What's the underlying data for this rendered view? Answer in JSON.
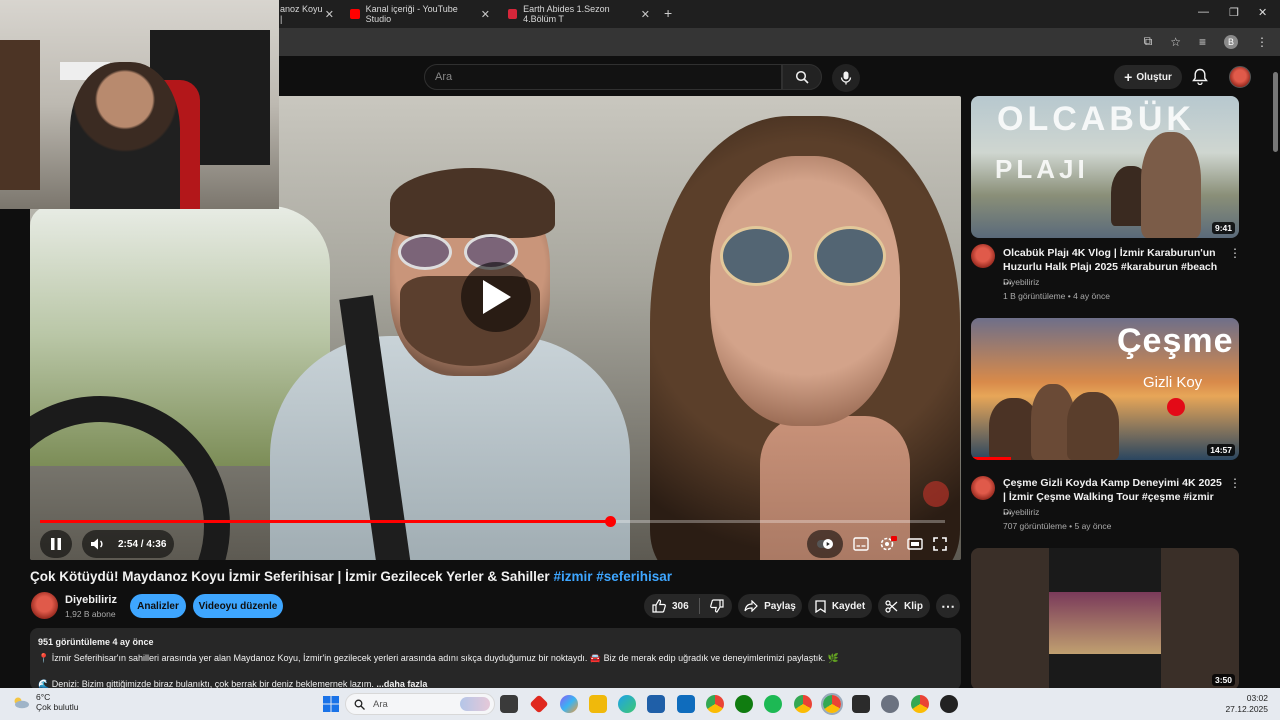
{
  "browser": {
    "tabs": [
      {
        "label": "anoz Koyu | "
      },
      {
        "label": "Kanal içeriği - YouTube Studio"
      },
      {
        "label": "Earth Abides 1.Sezon 4.Bölüm T"
      }
    ],
    "profile_letter": "B"
  },
  "masthead": {
    "search_placeholder": "Ara",
    "create_label": "Oluştur"
  },
  "player": {
    "current_time": "2:54",
    "duration": "4:36",
    "progress_fraction": 0.63
  },
  "video": {
    "title": "Çok Kötüydü! Maydanoz Koyu İzmir Seferihisar | İzmir Gezilecek Yerler & Sahiller ",
    "hashtags": "#izmir #seferihisar",
    "channel_name": "Diyebiliriz",
    "subscribers": "1,92 B abone",
    "analytics_label": "Analizler",
    "edit_label": "Videoyu düzenle",
    "like_count": "306",
    "share_label": "Paylaş",
    "save_label": "Kaydet",
    "clip_label": "Klip"
  },
  "description": {
    "meta": "951 görüntüleme  4 ay önce",
    "line1": "📍 İzmir Seferihisar'ın sahilleri arasında yer alan Maydanoz Koyu, İzmir'in gezilecek yerleri arasında adını sıkça duyduğumuz bir noktaydı. 🚘 Biz de merak edip uğradık ve deneyimlerimizi paylaştık. 🌿",
    "line2": "🌊 Denizi: Bizim gittiğimizde biraz bulanıktı, çok berrak bir deniz beklemernek lazım.",
    "more": "...daha fazla"
  },
  "recommendations": [
    {
      "thumb_text_1": "OLCABÜK",
      "thumb_text_2": "PLAJI",
      "duration": "9:41",
      "title": "Olcabük Plajı 4K Vlog | İzmir Karaburun'un Huzurlu Halk Plajı 2025 #karaburun #beach ...",
      "channel": "Diyebiliriz",
      "meta": "1 B görüntüleme • 4 ay önce"
    },
    {
      "thumb_text_1": "Çeşme",
      "thumb_text_2": "Gizli Koy",
      "duration": "14:57",
      "title": "Çeşme Gizli Koyda Kamp Deneyimi 4K 2025 | İzmir Çeşme Walking Tour #çeşme #izmir ...",
      "channel": "Diyebiliriz",
      "meta": "707 görüntüleme • 5 ay önce"
    },
    {
      "duration": "3:50"
    }
  ],
  "taskbar": {
    "temperature": "6°C",
    "condition": "Çok bulutlu",
    "search_placeholder": "Ara",
    "time": "03:02",
    "date": "27.12.2025"
  },
  "colors": {
    "accent_red": "#ff0000",
    "link_blue": "#3ea6ff"
  }
}
